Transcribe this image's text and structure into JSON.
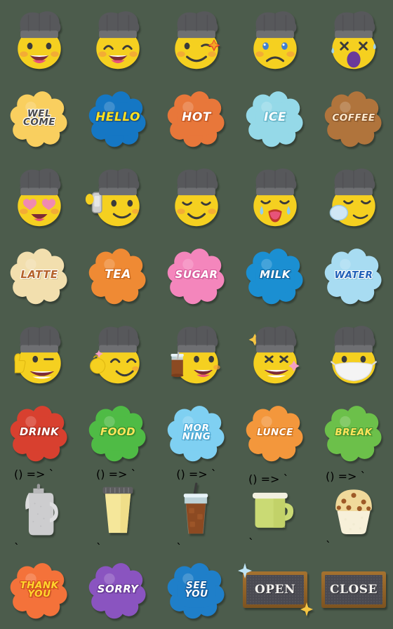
{
  "sheet": {
    "title": "Barista Chef Emoji Sticker Sheet",
    "columns": 5,
    "rows": 8,
    "background_color": "#4c5c4c"
  },
  "rows": [
    {
      "kind": "face",
      "items": [
        {
          "name": "chef-face-grin",
          "label": "grinning chef face",
          "hat_color": "#57585b",
          "face_color": "#f5d020",
          "mouth_color": "#e8537a"
        },
        {
          "name": "chef-face-smile-eyes",
          "label": "smiling chef face",
          "hat_color": "#57585b",
          "face_color": "#f5d020",
          "mouth_color": "#e8537a"
        },
        {
          "name": "chef-face-wink-star",
          "label": "winking chef face sparkle",
          "hat_color": "#57585b",
          "face_color": "#f5d020",
          "mouth_color": "#3b3b3b"
        },
        {
          "name": "chef-face-sad",
          "label": "sad teary chef face",
          "hat_color": "#57585b",
          "face_color": "#f5d020",
          "mouth_color": "#3b3b3b"
        },
        {
          "name": "chef-face-dizzy-scream",
          "label": "dizzy screaming chef face",
          "hat_color": "#57585b",
          "face_color": "#f5d020",
          "mouth_color": "#6a3a9a"
        }
      ]
    },
    {
      "kind": "badge",
      "items": [
        {
          "name": "badge-welcome",
          "lines": [
            "WEL",
            "COME"
          ],
          "fill": "#f9cf5f",
          "text": "#4a4a4a",
          "outline": "#ffffff",
          "size": "t3"
        },
        {
          "name": "badge-hello",
          "lines": [
            "HELLO"
          ],
          "fill": "#1577c4",
          "text": "#ffe11f",
          "outline": "#1a4f86",
          "size": "t1"
        },
        {
          "name": "badge-hot",
          "lines": [
            "HOT"
          ],
          "fill": "#e8773a",
          "text": "#ffffff",
          "outline": "#c6531e",
          "size": "t1"
        },
        {
          "name": "badge-ice",
          "lines": [
            "ICE"
          ],
          "fill": "#95d9e8",
          "text": "#ffffff",
          "outline": "#5fb6cc",
          "size": "t1"
        },
        {
          "name": "badge-coffee",
          "lines": [
            "COFFEE"
          ],
          "fill": "#b0743c",
          "text": "#fae7cc",
          "outline": "#8a5427",
          "size": "t3"
        }
      ]
    },
    {
      "kind": "face",
      "items": [
        {
          "name": "chef-face-heart-eyes",
          "label": "heart eyes chef face",
          "hat_color": "#57585b",
          "face_color": "#f5d020",
          "mouth_color": "#e8537a"
        },
        {
          "name": "chef-face-phone-call",
          "label": "chef face on phone call",
          "hat_color": "#57585b",
          "face_color": "#f5d020",
          "mouth_color": "#3b3b3b"
        },
        {
          "name": "chef-face-content",
          "label": "content chef face",
          "hat_color": "#57585b",
          "face_color": "#f5d020",
          "mouth_color": "#3b3b3b"
        },
        {
          "name": "chef-face-crying",
          "label": "crying yawning chef face",
          "hat_color": "#57585b",
          "face_color": "#f5d020",
          "mouth_color": "#e8537a"
        },
        {
          "name": "chef-face-sleeping",
          "label": "sleeping chef face bubble",
          "hat_color": "#57585b",
          "face_color": "#f5d020",
          "mouth_color": "#3b3b3b"
        }
      ]
    },
    {
      "kind": "badge",
      "items": [
        {
          "name": "badge-latte",
          "lines": [
            "LATTE"
          ],
          "fill": "#f2dfae",
          "text": "#b5632c",
          "outline": "#ffffff",
          "size": "t2"
        },
        {
          "name": "badge-tea",
          "lines": [
            "TEA"
          ],
          "fill": "#ef8a34",
          "text": "#ffffff",
          "outline": "#cf6617",
          "size": "t1"
        },
        {
          "name": "badge-sugar",
          "lines": [
            "SUGAR"
          ],
          "fill": "#f486bc",
          "text": "#ffffff",
          "outline": "#d85d9d",
          "size": "t2"
        },
        {
          "name": "badge-milk",
          "lines": [
            "MILK"
          ],
          "fill": "#1b8fd2",
          "text": "#ffffff",
          "outline": "#1368a2",
          "size": "t2"
        },
        {
          "name": "badge-water",
          "lines": [
            "WATER"
          ],
          "fill": "#a8dcf2",
          "text": "#2060b8",
          "outline": "#ffffff",
          "size": "t3"
        }
      ]
    },
    {
      "kind": "face",
      "items": [
        {
          "name": "chef-face-thumbs-up",
          "label": "thumbs up grinning chef",
          "hat_color": "#57585b",
          "face_color": "#f5d020",
          "mouth_color": "#ffffff"
        },
        {
          "name": "chef-face-ok-hand",
          "label": "ok hand smiling chef",
          "hat_color": "#57585b",
          "face_color": "#f5d020",
          "mouth_color": "#3b3b3b"
        },
        {
          "name": "chef-face-holding-drink",
          "label": "chef holding iced coffee",
          "hat_color": "#57585b",
          "face_color": "#f5d020",
          "mouth_color": "#e8537a"
        },
        {
          "name": "chef-face-star-struck",
          "label": "star struck excited chef",
          "hat_color": "#57585b",
          "face_color": "#f5d020",
          "mouth_color": "#ffffff"
        },
        {
          "name": "chef-face-mask",
          "label": "chef face with medical mask",
          "hat_color": "#57585b",
          "face_color": "#f5d020",
          "mouth_color": "#f2f2f2"
        }
      ]
    },
    {
      "kind": "badge",
      "items": [
        {
          "name": "badge-drink",
          "lines": [
            "DRINK"
          ],
          "fill": "#d8402f",
          "text": "#ffffff",
          "outline": "#a82a1d",
          "size": "t2"
        },
        {
          "name": "badge-food",
          "lines": [
            "FOOD"
          ],
          "fill": "#4fbb45",
          "text": "#ffe45c",
          "outline": "#2f8f2a",
          "size": "t2"
        },
        {
          "name": "badge-morning",
          "lines": [
            "MOR",
            "NING"
          ],
          "fill": "#7fd0f2",
          "text": "#ffffff",
          "outline": "#49a7d4",
          "size": "t3"
        },
        {
          "name": "badge-lunce",
          "lines": [
            "LUNCE"
          ],
          "fill": "#f3973c",
          "text": "#ffffff",
          "outline": "#d1721b",
          "size": "t3"
        },
        {
          "name": "badge-break",
          "lines": [
            "BREAK"
          ],
          "fill": "#6cc04a",
          "text": "#ffe45c",
          "outline": "#44922c",
          "size": "t3"
        }
      ]
    },
    {
      "kind": "object",
      "items": [
        {
          "name": "coffee-pot",
          "label": "silver coffee pot",
          "color": "#cdcdcf"
        },
        {
          "name": "takeaway-cup",
          "label": "yellow takeaway cup",
          "color": "#f5e79a"
        },
        {
          "name": "iced-coffee-glass",
          "label": "iced coffee glass",
          "color": "#8c4a22"
        },
        {
          "name": "green-mug",
          "label": "green mug",
          "color": "#cada74"
        },
        {
          "name": "choc-chip-muffin",
          "label": "chocolate chip muffin",
          "color": "#f0d99b"
        }
      ]
    },
    {
      "kind": "mixed",
      "items": [
        {
          "kind": "badge",
          "name": "badge-thank-you",
          "lines": [
            "THANK",
            "YOU"
          ],
          "fill": "#f4723a",
          "text": "#ffd52e",
          "outline": "#d14c1b",
          "size": "t3"
        },
        {
          "kind": "badge",
          "name": "badge-sorry",
          "lines": [
            "SORRY"
          ],
          "fill": "#8a54c0",
          "text": "#ffffff",
          "outline": "#653795",
          "size": "t2"
        },
        {
          "kind": "badge",
          "name": "badge-see-you",
          "lines": [
            "SEE",
            "YOU"
          ],
          "fill": "#1f7fc9",
          "text": "#ffffff",
          "outline": "#14599a",
          "size": "t3"
        },
        {
          "kind": "sign",
          "name": "sign-open",
          "label": "OPEN",
          "frame": "#8a5b24",
          "panel": "#4a4a52",
          "text": "#f4f2ee",
          "sparkles": true
        },
        {
          "kind": "sign",
          "name": "sign-close",
          "label": "CLOSE",
          "frame": "#8a5b24",
          "panel": "#4a4a52",
          "text": "#f4f2ee",
          "sparkles": false
        }
      ]
    }
  ]
}
